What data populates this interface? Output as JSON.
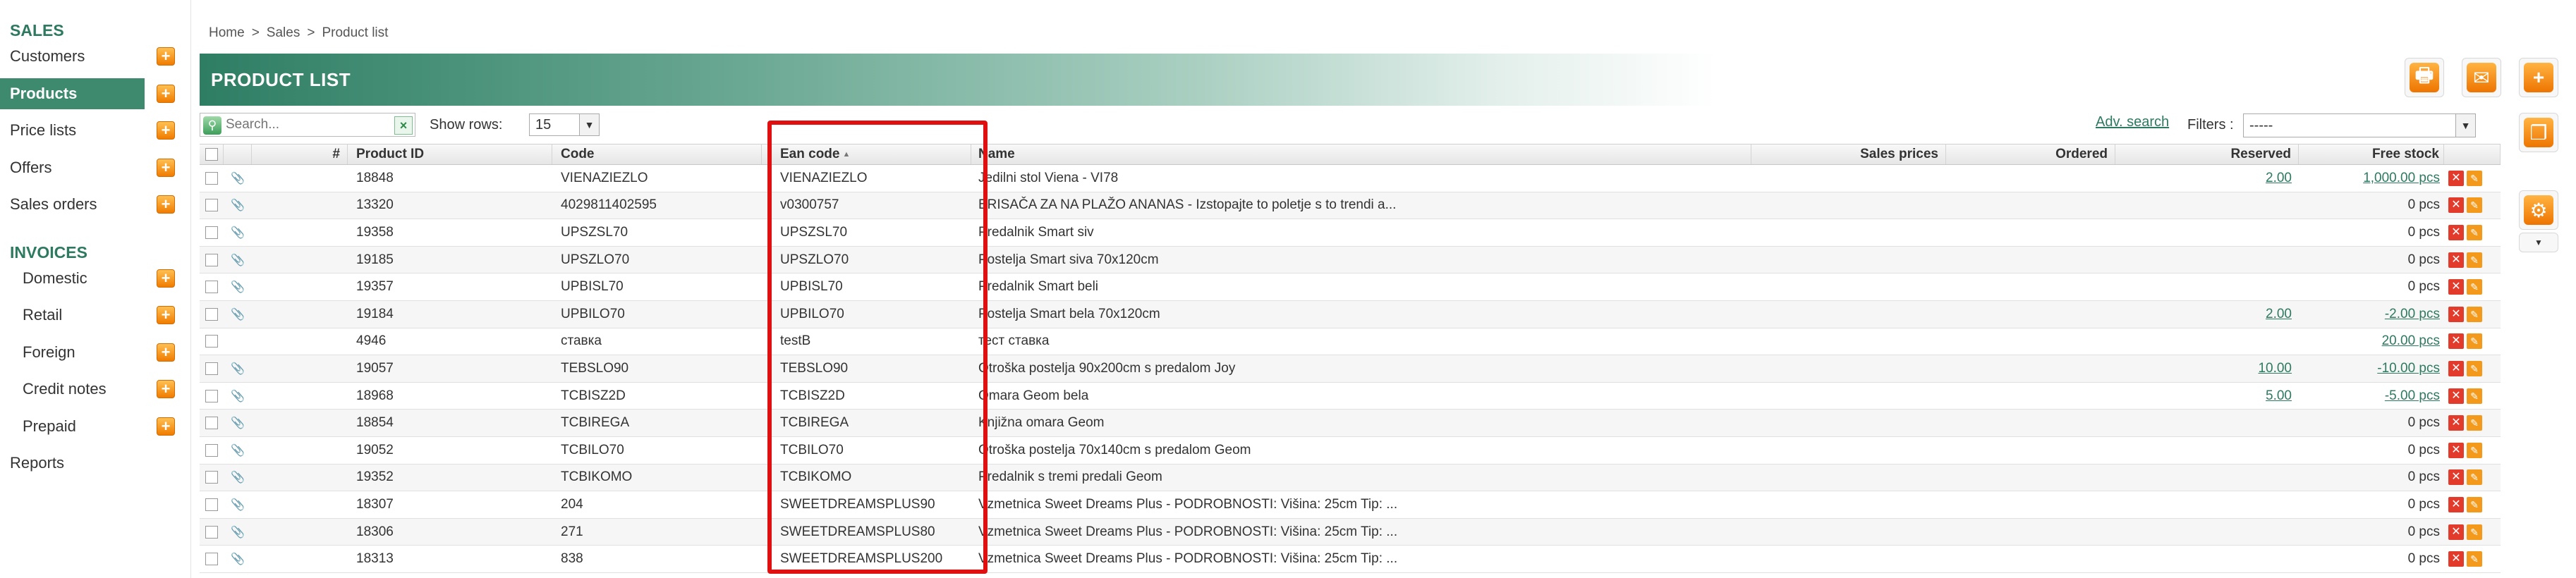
{
  "sidebar": {
    "sections": [
      {
        "heading": "SALES",
        "items": [
          {
            "label": "Customers",
            "add": true,
            "active": false,
            "sub": false
          },
          {
            "label": "Products",
            "add": true,
            "active": true,
            "sub": false
          },
          {
            "label": "Price lists",
            "add": true,
            "active": false,
            "sub": false
          },
          {
            "label": "Offers",
            "add": true,
            "active": false,
            "sub": false
          },
          {
            "label": "Sales orders",
            "add": true,
            "active": false,
            "sub": false
          }
        ]
      },
      {
        "heading": "INVOICES",
        "items": [
          {
            "label": "Domestic",
            "add": true,
            "active": false,
            "sub": true
          },
          {
            "label": "Retail",
            "add": true,
            "active": false,
            "sub": true
          },
          {
            "label": "Foreign",
            "add": true,
            "active": false,
            "sub": true
          },
          {
            "label": "Credit notes",
            "add": true,
            "active": false,
            "sub": true
          },
          {
            "label": "Prepaid",
            "add": true,
            "active": false,
            "sub": true
          },
          {
            "label": "Reports",
            "add": false,
            "active": false,
            "sub": false
          }
        ]
      }
    ],
    "add_glyph": "+"
  },
  "breadcrumb": [
    "Home",
    ">",
    "Sales",
    ">",
    "Product list"
  ],
  "page": {
    "title": "PRODUCT LIST"
  },
  "toolbar": {
    "search_placeholder": "Search...",
    "search_icon": "search-icon",
    "clear_glyph": "×",
    "show_rows_label": "Show rows:",
    "rows_value": "15",
    "adv_search": "Adv. search",
    "filters_label": "Filters :",
    "filters_value": "-----",
    "dropdown_glyph": "▼"
  },
  "right_buttons": [
    {
      "name": "print-button",
      "glyph": "🖶"
    },
    {
      "name": "email-button",
      "glyph": "✉"
    },
    {
      "name": "add-product-button",
      "glyph": "+"
    },
    {
      "name": "copy-button",
      "glyph": "❐"
    },
    {
      "name": "settings-button",
      "glyph": "⚙"
    }
  ],
  "settings_dropdown_glyph": "▼",
  "table": {
    "headers": {
      "num": "#",
      "pid": "Product ID",
      "code": "Code",
      "ean": "Ean code",
      "name": "Name",
      "sales": "Sales prices",
      "ordered": "Ordered",
      "reserved": "Reserved",
      "free": "Free stock"
    },
    "sort_glyph": "▲",
    "clip_glyph": "📎",
    "del_glyph": "✕",
    "edit_glyph": "✎",
    "rows": [
      {
        "pid": "18848",
        "code": "VIENAZIEZLO",
        "ean": "VIENAZIEZLO",
        "name": "Jedilni stol Viena - VI78",
        "reserved": "2.00",
        "free": "1,000.00 pcs",
        "free_link": true,
        "clip": true
      },
      {
        "pid": "13320",
        "code": "4029811402595",
        "ean": "v0300757",
        "name": "BRISAČA ZA NA PLAŽO ANANAS - Izstopajte to poletje s to trendi a...",
        "reserved": "",
        "free": "0 pcs",
        "free_link": false,
        "clip": true
      },
      {
        "pid": "19358",
        "code": "UPSZSL70",
        "ean": "UPSZSL70",
        "name": "Predalnik Smart siv",
        "reserved": "",
        "free": "0 pcs",
        "free_link": false,
        "clip": true
      },
      {
        "pid": "19185",
        "code": "UPSZLO70",
        "ean": "UPSZLO70",
        "name": "Postelja Smart siva 70x120cm",
        "reserved": "",
        "free": "0 pcs",
        "free_link": false,
        "clip": true
      },
      {
        "pid": "19357",
        "code": "UPBISL70",
        "ean": "UPBISL70",
        "name": "Predalnik Smart beli",
        "reserved": "",
        "free": "0 pcs",
        "free_link": false,
        "clip": true
      },
      {
        "pid": "19184",
        "code": "UPBILO70",
        "ean": "UPBILO70",
        "name": "Postelja Smart bela 70x120cm",
        "reserved": "2.00",
        "free": "-2.00 pcs",
        "free_link": true,
        "clip": true
      },
      {
        "pid": "4946",
        "code": "ставка",
        "ean": "testB",
        "name": "тест ставка",
        "reserved": "",
        "free": "20.00 pcs",
        "free_link": true,
        "clip": false
      },
      {
        "pid": "19057",
        "code": "TEBSLO90",
        "ean": "TEBSLO90",
        "name": "Otroška postelja 90x200cm s predalom Joy",
        "reserved": "10.00",
        "free": "-10.00 pcs",
        "free_link": true,
        "clip": true
      },
      {
        "pid": "18968",
        "code": "TCBISZ2D",
        "ean": "TCBISZ2D",
        "name": "Omara Geom bela",
        "reserved": "5.00",
        "free": "-5.00 pcs",
        "free_link": true,
        "clip": true
      },
      {
        "pid": "18854",
        "code": "TCBIREGA",
        "ean": "TCBIREGA",
        "name": "Knjižna omara Geom",
        "reserved": "",
        "free": "0 pcs",
        "free_link": false,
        "clip": true
      },
      {
        "pid": "19052",
        "code": "TCBILO70",
        "ean": "TCBILO70",
        "name": "Otroška postelja 70x140cm s predalom Geom",
        "reserved": "",
        "free": "0 pcs",
        "free_link": false,
        "clip": true
      },
      {
        "pid": "19352",
        "code": "TCBIKOMO",
        "ean": "TCBIKOMO",
        "name": "Predalnik s tremi predali Geom",
        "reserved": "",
        "free": "0 pcs",
        "free_link": false,
        "clip": true
      },
      {
        "pid": "18307",
        "code": "204",
        "ean": "SWEETDREAMSPLUS90",
        "name": "Vzmetnica Sweet Dreams Plus - PODROBNOSTI: Višina: 25cm Tip: ...",
        "reserved": "",
        "free": "0 pcs",
        "free_link": false,
        "clip": true
      },
      {
        "pid": "18306",
        "code": "271",
        "ean": "SWEETDREAMSPLUS80",
        "name": "Vzmetnica Sweet Dreams Plus - PODROBNOSTI: Višina: 25cm Tip: ...",
        "reserved": "",
        "free": "0 pcs",
        "free_link": false,
        "clip": true
      },
      {
        "pid": "18313",
        "code": "838",
        "ean": "SWEETDREAMSPLUS200",
        "name": "Vzmetnica Sweet Dreams Plus - PODROBNOSTI: Višina: 25cm Tip: ...",
        "reserved": "",
        "free": "0 pcs",
        "free_link": false,
        "clip": true
      }
    ]
  },
  "colors": {
    "accent": "#2d7a60",
    "active_nav": "#3d8a6f",
    "add_button": "#f07c00",
    "highlight": "#e01010"
  }
}
